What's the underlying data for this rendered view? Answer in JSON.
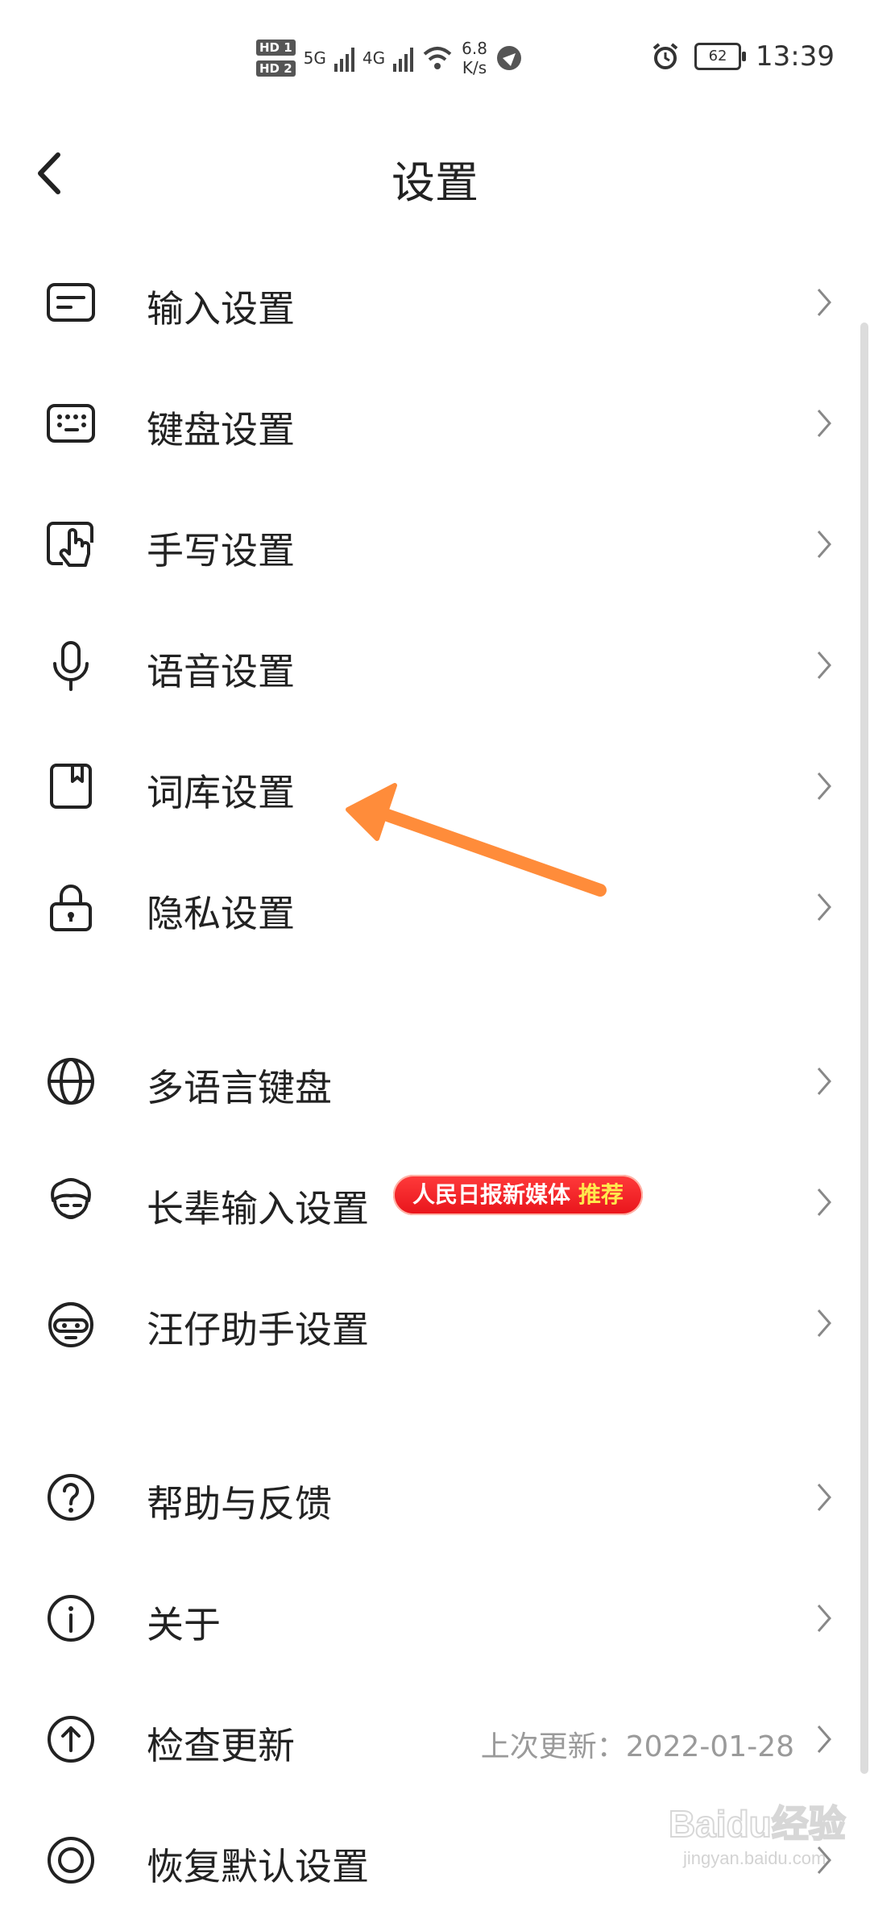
{
  "status_bar": {
    "sim1": "HD 1",
    "sim2": "HD 2",
    "net1": "5G",
    "net2": "4G",
    "speed_value": "6.8",
    "speed_unit": "K/s",
    "battery": "62",
    "time": "13:39"
  },
  "header": {
    "title": "设置"
  },
  "group1": [
    {
      "label": "输入设置",
      "icon": "input-icon"
    },
    {
      "label": "键盘设置",
      "icon": "keyboard-icon"
    },
    {
      "label": "手写设置",
      "icon": "handwriting-icon"
    },
    {
      "label": "语音设置",
      "icon": "microphone-icon"
    },
    {
      "label": "词库设置",
      "icon": "dictionary-icon"
    },
    {
      "label": "隐私设置",
      "icon": "lock-icon"
    }
  ],
  "group2": [
    {
      "label": "多语言键盘",
      "icon": "globe-icon"
    },
    {
      "label": "长辈输入设置",
      "icon": "elder-face-icon",
      "badge": "人民日报新媒体",
      "badge_hot": "推荐"
    },
    {
      "label": "汪仔助手设置",
      "icon": "assistant-face-icon"
    }
  ],
  "group3": [
    {
      "label": "帮助与反馈",
      "icon": "help-icon"
    },
    {
      "label": "关于",
      "icon": "info-icon"
    },
    {
      "label": "检查更新",
      "icon": "update-icon",
      "extra": "上次更新：2022-01-28"
    },
    {
      "label": "恢复默认设置",
      "icon": "restore-icon"
    }
  ],
  "watermark": {
    "text": "Baidu经验",
    "sub": "jingyan.baidu.com"
  },
  "colors": {
    "annotation_arrow": "#ff8c3a",
    "badge_bg": "#e8141b",
    "badge_hot": "#ffe94d"
  }
}
